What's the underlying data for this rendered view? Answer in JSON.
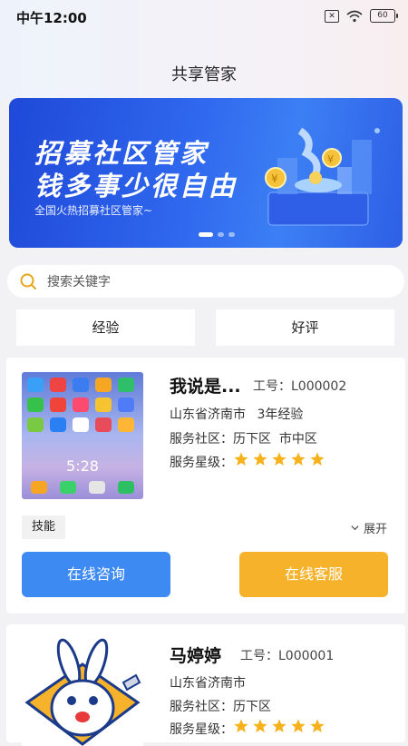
{
  "status_bar": {
    "time": "中午12:00",
    "battery": "60"
  },
  "page": {
    "title": "共享管家"
  },
  "banner": {
    "line1": "招募社区管家",
    "line2": "钱多事少很自由",
    "subtitle": "全国火热招募社区管家~"
  },
  "search": {
    "placeholder": "搜索关键字"
  },
  "filters": {
    "experience": "经验",
    "rating": "好评"
  },
  "cards": [
    {
      "name": "我说是...",
      "work_id": "工号：L000002",
      "location": "山东省济南市",
      "experience": "3年经验",
      "community_label": "服务社区：",
      "communities": "历下区  市中区",
      "stars_label": "服务星级：",
      "stars": 5,
      "skill_tag": "技能",
      "expand": "展开",
      "consult_button": "在线咨询",
      "service_button": "在线客服",
      "phone_clock": "5:28"
    },
    {
      "name": "马婷婷",
      "work_id": "工号：L000001",
      "location": "山东省济南市",
      "community_label": "服务社区：",
      "communities": "历下区",
      "stars_label": "服务星级：",
      "stars": 5
    }
  ],
  "colors": {
    "primary": "#3e8af3",
    "accent": "#f6b22b",
    "star": "#f7b11b"
  }
}
